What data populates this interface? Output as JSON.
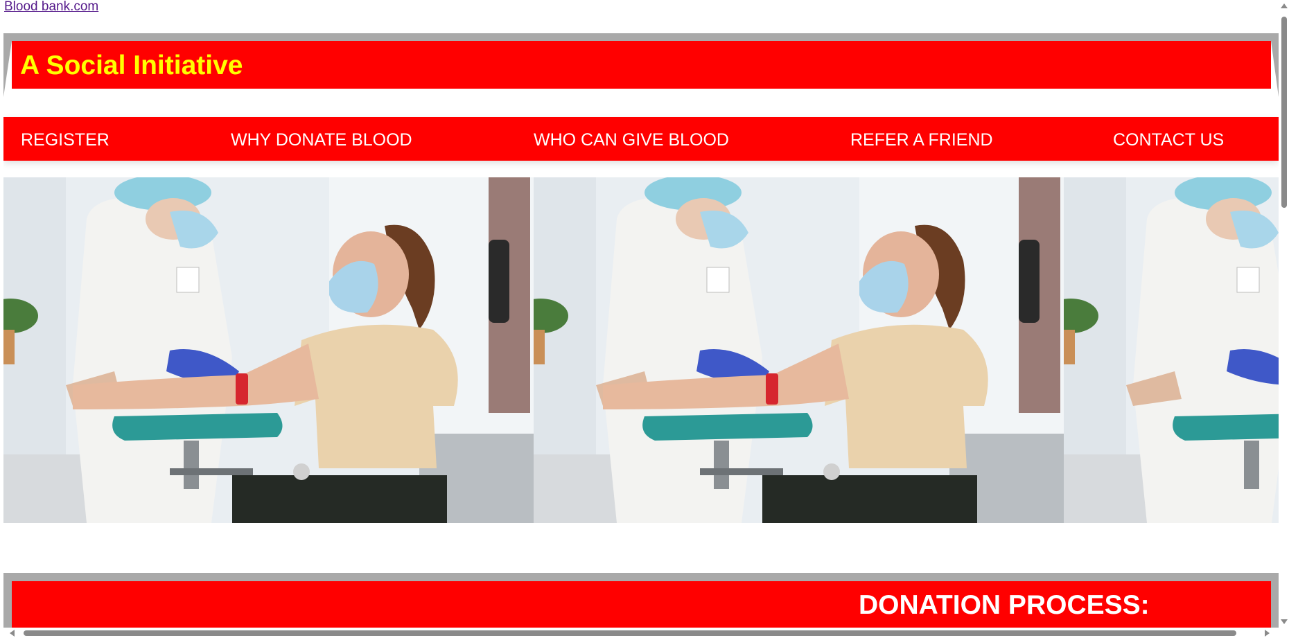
{
  "top_link": {
    "label": "Blood bank.com"
  },
  "header": {
    "title": "A Social Initiative"
  },
  "nav": {
    "items": [
      {
        "label": "REGISTER"
      },
      {
        "label": "WHY DONATE BLOOD"
      },
      {
        "label": "WHO CAN GIVE BLOOD"
      },
      {
        "label": "REFER A FRIEND"
      },
      {
        "label": "CONTACT US"
      }
    ]
  },
  "hero": {
    "image_subject": "nurse in mask and blue gloves taking blood from woman donor seated in donation chair",
    "tile_count": 3
  },
  "section": {
    "title": "DONATION PROCESS:"
  },
  "colors": {
    "header_red": "#ff0000",
    "title_yellow": "#ffff00",
    "frame_grey": "#a9a9a9",
    "nav_text": "#ffffff",
    "link_visited": "#551a8b"
  }
}
